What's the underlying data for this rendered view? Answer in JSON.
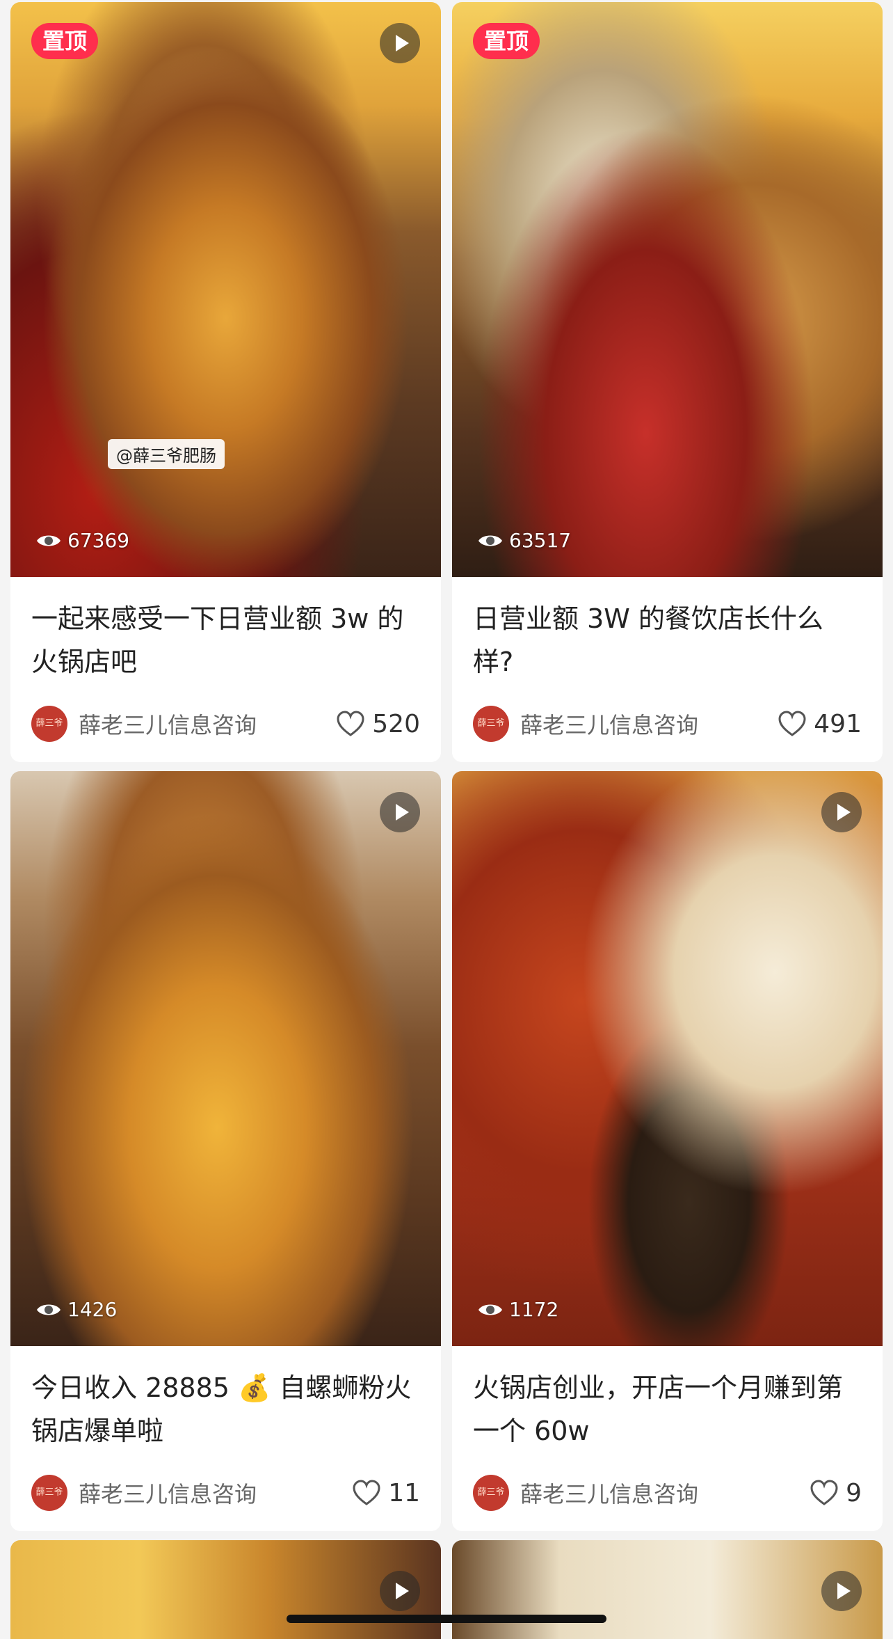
{
  "feed": {
    "cards": [
      {
        "pinned_label": "置顶",
        "views": "67369",
        "watermark": "@薛三爷肥肠",
        "title": "一起来感受一下日营业额 3w 的火锅店吧",
        "author": "薛老三儿信息咨询",
        "avatar_text": "薛三爷",
        "likes": "520"
      },
      {
        "pinned_label": "置顶",
        "views": "63517",
        "title": "日营业额 3W 的餐饮店长什么样?",
        "author": "薛老三儿信息咨询",
        "avatar_text": "薛三爷",
        "likes": "491"
      },
      {
        "views": "1426",
        "title": "今日收入 28885 💰 自螺蛳粉火锅店爆单啦",
        "author": "薛老三儿信息咨询",
        "avatar_text": "薛三爷",
        "likes": "11"
      },
      {
        "views": "1172",
        "title": "火锅店创业，开店一个月赚到第一个 60w",
        "author": "薛老三儿信息咨询",
        "avatar_text": "薛三爷",
        "likes": "9"
      }
    ]
  },
  "colors": {
    "pin_badge": "#ff2e4d",
    "avatar": "#c23a2e",
    "page_bg": "#f4f4f4"
  },
  "icons": [
    "play-icon",
    "eye-icon",
    "heart-icon"
  ]
}
